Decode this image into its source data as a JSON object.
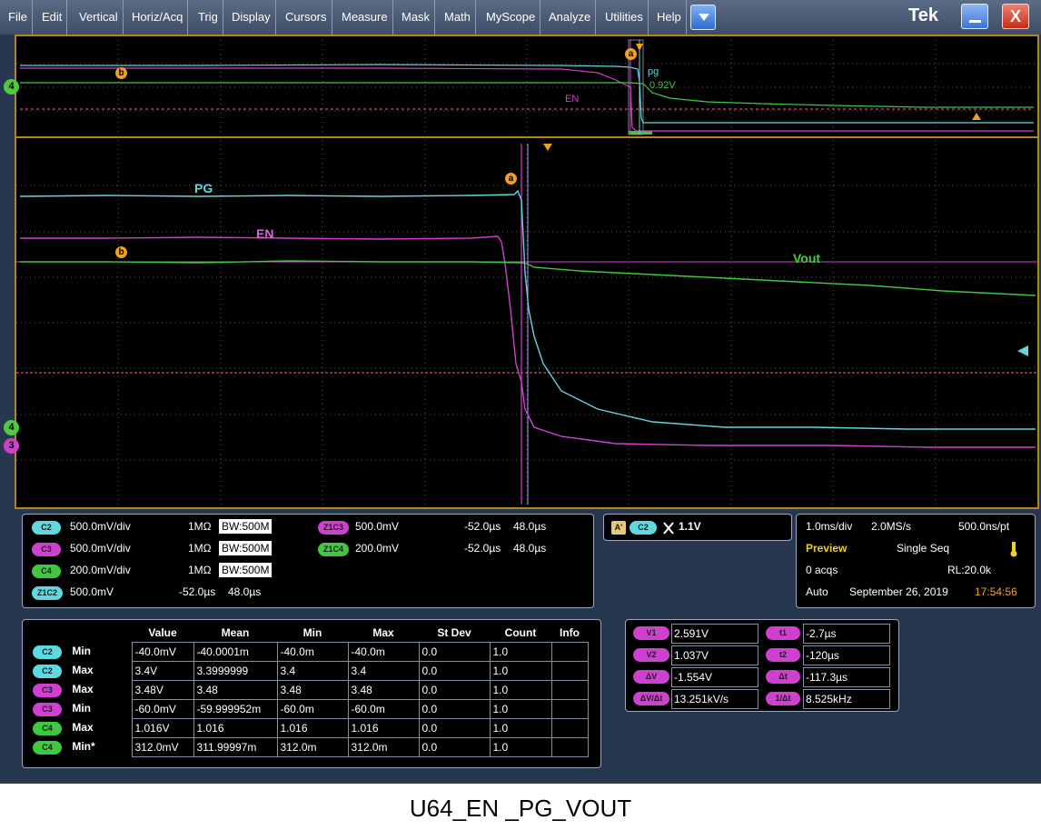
{
  "menu": {
    "items": [
      "File",
      "Edit",
      "Vertical",
      "Horiz/Acq",
      "Trig",
      "Display",
      "Cursors",
      "Measure",
      "Mask",
      "Math",
      "MyScope",
      "Analyze",
      "Utilities",
      "Help"
    ],
    "brand": "Tek",
    "dropdown_icon": "chevron-down-icon",
    "minimize_icon": "minimize-icon",
    "close_icon": "close-icon",
    "close_label": "X"
  },
  "waveform": {
    "overview_labels": {
      "pg": "pg",
      "en": "EN",
      "level": "0.92V"
    },
    "main_labels": {
      "pg": "PG",
      "en": "EN",
      "vout": "Vout"
    },
    "cursor_a": "a",
    "cursor_b": "b",
    "channel_markers": [
      "4",
      "4",
      "3"
    ],
    "colors": {
      "c2": "#5fd8e0",
      "c3": "#d040d0",
      "c4": "#40c840",
      "cursor": "#f0a020",
      "grid": "#6a6a6a"
    }
  },
  "channels": {
    "rows": [
      {
        "badge": "C2",
        "scale": "500.0mV/div",
        "imp": "1MΩ",
        "bw": "BW:500M"
      },
      {
        "badge": "C3",
        "scale": "500.0mV/div",
        "imp": "1MΩ",
        "bw": "BW:500M"
      },
      {
        "badge": "C4",
        "scale": "200.0mV/div",
        "imp": "1MΩ",
        "bw": "BW:500M"
      }
    ],
    "zoom_rows": [
      {
        "badge": "Z1C2",
        "scale": "500.0mV",
        "pos": "-52.0µs",
        "width": "48.0µs"
      },
      {
        "badge": "Z1C3",
        "scale": "500.0mV",
        "pos": "-52.0µs",
        "width": "48.0µs"
      },
      {
        "badge": "Z1C4",
        "scale": "200.0mV",
        "pos": "-52.0µs",
        "width": "48.0µs"
      }
    ]
  },
  "trigger": {
    "badge_a": "A'",
    "badge_ch": "C2",
    "slope_icon": "trigger-slope-icon",
    "level": "1.1V"
  },
  "horizontal": {
    "scale": "1.0ms/div",
    "rate": "2.0MS/s",
    "resolution": "500.0ns/pt",
    "mode": "Preview",
    "seq": "Single Seq",
    "acqs": "0 acqs",
    "rl": "RL:20.0k",
    "auto": "Auto",
    "date": "September 26, 2019",
    "time": "17:54:56",
    "temp_icon": "thermometer-icon"
  },
  "measurements": {
    "headers": [
      "Value",
      "Mean",
      "Min",
      "Max",
      "St Dev",
      "Count",
      "Info"
    ],
    "rows": [
      {
        "ch": "C2",
        "label": "Min",
        "value": "-40.0mV",
        "mean": "-40.0001m",
        "min": "-40.0m",
        "max": "-40.0m",
        "stdev": "0.0",
        "count": "1.0"
      },
      {
        "ch": "C2",
        "label": "Max",
        "value": "3.4V",
        "mean": "3.3999999",
        "min": "3.4",
        "max": "3.4",
        "stdev": "0.0",
        "count": "1.0"
      },
      {
        "ch": "C3",
        "label": "Max",
        "value": "3.48V",
        "mean": "3.48",
        "min": "3.48",
        "max": "3.48",
        "stdev": "0.0",
        "count": "1.0"
      },
      {
        "ch": "C3",
        "label": "Min",
        "value": "-60.0mV",
        "mean": "-59.999952m",
        "min": "-60.0m",
        "max": "-60.0m",
        "stdev": "0.0",
        "count": "1.0"
      },
      {
        "ch": "C4",
        "label": "Max",
        "value": "1.016V",
        "mean": "1.016",
        "min": "1.016",
        "max": "1.016",
        "stdev": "0.0",
        "count": "1.0"
      },
      {
        "ch": "C4",
        "label": "Min*",
        "value": "312.0mV",
        "mean": "311.99997m",
        "min": "312.0m",
        "max": "312.0m",
        "stdev": "0.0",
        "count": "1.0"
      }
    ]
  },
  "cursors": {
    "left": [
      {
        "badge": "V1",
        "value": "2.591V"
      },
      {
        "badge": "V2",
        "value": "1.037V"
      },
      {
        "badge": "ΔV",
        "value": "-1.554V"
      },
      {
        "badge": "ΔV/Δt",
        "value": "13.251kV/s"
      }
    ],
    "right": [
      {
        "badge": "t1",
        "value": "-2.7µs"
      },
      {
        "badge": "t2",
        "value": "-120µs"
      },
      {
        "badge": "Δt",
        "value": "-117.3µs"
      },
      {
        "badge": "1/Δt",
        "value": "8.525kHz"
      }
    ]
  },
  "caption": "U64_EN _PG_VOUT"
}
